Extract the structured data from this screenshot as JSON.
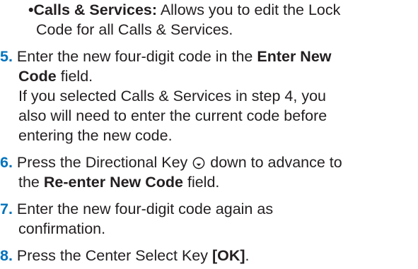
{
  "bullet": {
    "symbol": "•",
    "term": "Calls & Services:",
    "text_line1": " Allows you to edit the Lock",
    "text_line2": "Code for all Calls & Services."
  },
  "steps": [
    {
      "number": "5.",
      "line1_pre": "Enter the new four-digit code in the ",
      "line1_bold": "Enter New",
      "line2_bold": "Code",
      "line2_post": " field.",
      "note_line1": "If you selected Calls & Services in step 4, you",
      "note_line2": "also will need to enter the current code before",
      "note_line3": "entering the new code."
    },
    {
      "number": "6.",
      "line1_pre": "Press the Directional Key ",
      "icon": "directional-key-down-icon",
      "line1_post": " down to advance to",
      "line2_pre": "the ",
      "line2_bold": "Re-enter New Code",
      "line2_post": " field."
    },
    {
      "number": "7.",
      "line1": "Enter the new four-digit code again as",
      "line2": "confirmation."
    },
    {
      "number": "8.",
      "line1_pre": "Press the Center Select Key ",
      "line1_bold": "[OK]",
      "line1_post": "."
    }
  ],
  "colors": {
    "step_number": "#0072bc",
    "text": "#231f20"
  }
}
